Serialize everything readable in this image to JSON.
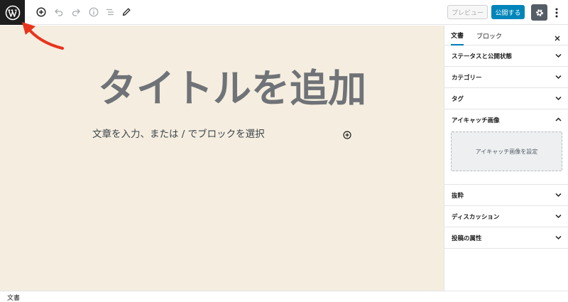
{
  "toolbar": {
    "logo_icon": "wordpress-logo-icon",
    "tools": [
      "add-block-icon",
      "undo-icon",
      "redo-icon",
      "info-icon",
      "list-view-icon",
      "edit-pencil-icon"
    ],
    "preview_label": "プレビュー",
    "publish_label": "公開する",
    "settings_icon": "gear-icon",
    "more_icon": "more-vertical-icon"
  },
  "editor": {
    "title_placeholder": "タイトルを追加",
    "body_placeholder": "文章を入力、または / でブロックを選択",
    "inline_add_icon": "plus-circle-icon"
  },
  "sidebar": {
    "tabs": [
      {
        "label": "文書",
        "active": true
      },
      {
        "label": "ブロック",
        "active": false
      }
    ],
    "close_icon": "close-icon",
    "panels": [
      {
        "label": "ステータスと公開状態",
        "expanded": false
      },
      {
        "label": "カテゴリー",
        "expanded": false
      },
      {
        "label": "タグ",
        "expanded": false
      },
      {
        "label": "アイキャッチ画像",
        "expanded": true,
        "button_label": "アイキャッチ画像を設定"
      },
      {
        "label": "抜粋",
        "expanded": false
      },
      {
        "label": "ディスカッション",
        "expanded": false
      },
      {
        "label": "投稿の属性",
        "expanded": false
      }
    ]
  },
  "footer": {
    "breadcrumb": "文書"
  },
  "colors": {
    "canvas_bg": "#f5eee0",
    "publish_blue": "#0085ba",
    "annotation_red": "#e8341c",
    "active_tab": "#007cba"
  }
}
